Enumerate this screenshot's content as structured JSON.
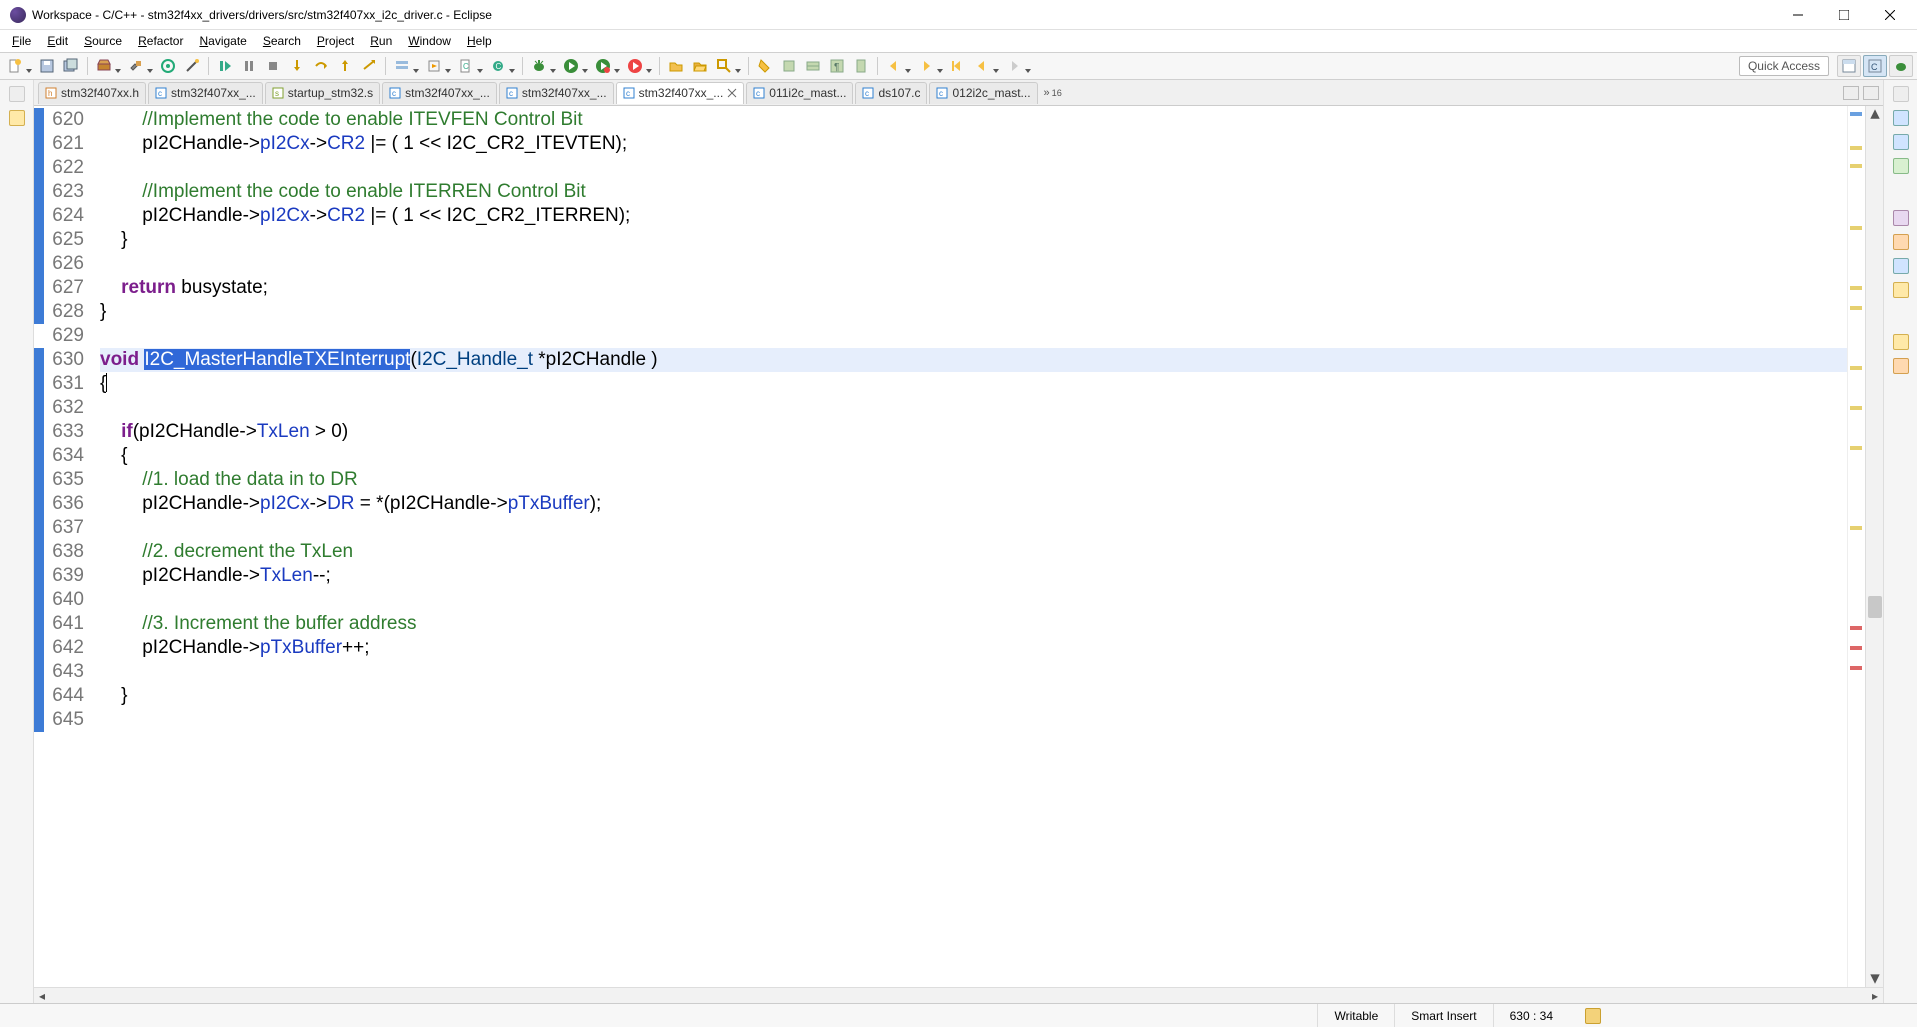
{
  "window": {
    "title": "Workspace - C/C++ - stm32f4xx_drivers/drivers/src/stm32f407xx_i2c_driver.c - Eclipse"
  },
  "menu": [
    "File",
    "Edit",
    "Source",
    "Refactor",
    "Navigate",
    "Search",
    "Project",
    "Run",
    "Window",
    "Help"
  ],
  "quick_access": "Quick Access",
  "tabs": [
    {
      "name": "stm32f407xx.h",
      "icon": "h"
    },
    {
      "name": "stm32f407xx_...",
      "icon": "c"
    },
    {
      "name": "startup_stm32.s",
      "icon": "s"
    },
    {
      "name": "stm32f407xx_...",
      "icon": "c"
    },
    {
      "name": "stm32f407xx_...",
      "icon": "c"
    },
    {
      "name": "stm32f407xx_...",
      "icon": "c",
      "active": true,
      "closeable": true
    },
    {
      "name": "011i2c_mast...",
      "icon": "c"
    },
    {
      "name": "ds107.c",
      "icon": "c"
    },
    {
      "name": "012i2c_mast...",
      "icon": "c"
    }
  ],
  "tab_overflow": "16",
  "code": {
    "startLine": 620,
    "lines": [
      {
        "n": 620,
        "html": "        <span class='comment'>//Implement the code to enable ITEVFEN Control Bit</span>"
      },
      {
        "n": 621,
        "html": "        pI2CHandle-&gt;<span class='member'>pI2Cx</span>-&gt;<span class='member'>CR2</span> |= ( 1 &lt;&lt; I2C_CR2_ITEVTEN);"
      },
      {
        "n": 622,
        "html": ""
      },
      {
        "n": 623,
        "html": "        <span class='comment'>//Implement the code to enable ITERREN Control Bit</span>"
      },
      {
        "n": 624,
        "html": "        pI2CHandle-&gt;<span class='member'>pI2Cx</span>-&gt;<span class='member'>CR2</span> |= ( 1 &lt;&lt; I2C_CR2_ITERREN);"
      },
      {
        "n": 625,
        "html": "    }"
      },
      {
        "n": 626,
        "html": ""
      },
      {
        "n": 627,
        "html": "    <span class='kwd'>return</span> busystate;"
      },
      {
        "n": 628,
        "html": "}"
      },
      {
        "n": 629,
        "html": ""
      },
      {
        "n": 630,
        "html": "<span class='kwd'>void</span> <span class='sel'>I2C_MasterHandleTXEInterrupt</span>(<span class='type'>I2C_Handle_t</span> *pI2CHandle )",
        "hl": true
      },
      {
        "n": 631,
        "html": "{<span class='text-cursor'></span>"
      },
      {
        "n": 632,
        "html": ""
      },
      {
        "n": 633,
        "html": "    <span class='kwd'>if</span>(pI2CHandle-&gt;<span class='member'>TxLen</span> &gt; 0)"
      },
      {
        "n": 634,
        "html": "    {"
      },
      {
        "n": 635,
        "html": "        <span class='comment'>//1. load the data in to DR</span>"
      },
      {
        "n": 636,
        "html": "        pI2CHandle-&gt;<span class='member'>pI2Cx</span>-&gt;<span class='member'>DR</span> = *(pI2CHandle-&gt;<span class='member'>pTxBuffer</span>);"
      },
      {
        "n": 637,
        "html": ""
      },
      {
        "n": 638,
        "html": "        <span class='comment'>//2. decrement the TxLen</span>"
      },
      {
        "n": 639,
        "html": "        pI2CHandle-&gt;<span class='member'>TxLen</span>--;"
      },
      {
        "n": 640,
        "html": ""
      },
      {
        "n": 641,
        "html": "        <span class='comment'>//3. Increment the buffer address</span>"
      },
      {
        "n": 642,
        "html": "        pI2CHandle-&gt;<span class='member'>pTxBuffer</span>++;"
      },
      {
        "n": 643,
        "html": ""
      },
      {
        "n": 644,
        "html": "    }"
      },
      {
        "n": 645,
        "html": ""
      }
    ],
    "blueMarkerRanges": [
      [
        620,
        628
      ],
      [
        630,
        645
      ]
    ]
  },
  "status": {
    "writable": "Writable",
    "insert": "Smart Insert",
    "pos": "630 : 34"
  }
}
